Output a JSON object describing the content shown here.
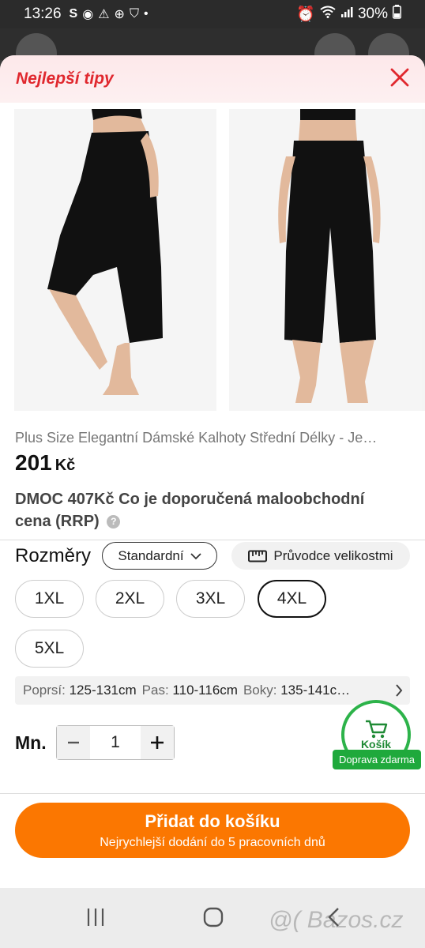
{
  "status_bar": {
    "time": "13:26",
    "left_icons": [
      "s-icon",
      "messenger-icon",
      "warning-icon",
      "web-icon",
      "shield-icon",
      "dot-icon"
    ],
    "battery": "30%"
  },
  "sheet": {
    "title": "Nejlepší tipy",
    "title_color": "#e0282e"
  },
  "product": {
    "images": [
      "black-capri-pants-side",
      "black-capri-pants-front"
    ],
    "title": "Plus Size Elegantní Dámské Kalhoty Střední Délky - Je…",
    "price": "201",
    "currency": "Kč",
    "rrp_text": "DMOC 407Kč Co je doporučená maloobchodní cena (RRP)",
    "help_glyph": "?"
  },
  "size": {
    "label": "Rozměry",
    "standard": "Standardní",
    "guide": "Průvodce velikostmi",
    "options": [
      "1XL",
      "2XL",
      "3XL",
      "4XL",
      "5XL"
    ],
    "selected": "4XL"
  },
  "measurements": {
    "bust_label": "Poprsí:",
    "bust_value": "125-131cm",
    "waist_label": "Pas:",
    "waist_value": "110-116cm",
    "hips_label": "Boky:",
    "hips_value": "135-141c…"
  },
  "quantity": {
    "label": "Mn.",
    "value": "1"
  },
  "cart": {
    "label": "Košík",
    "shipping": "Doprava zdarma",
    "color": "#2db34a"
  },
  "add_to_cart": {
    "label": "Přidat do košíku",
    "sub": "Nejrychlejší dodání do 5 pracovních dnů",
    "color": "#fb7701"
  },
  "watermark": "@( Bazos.cz"
}
